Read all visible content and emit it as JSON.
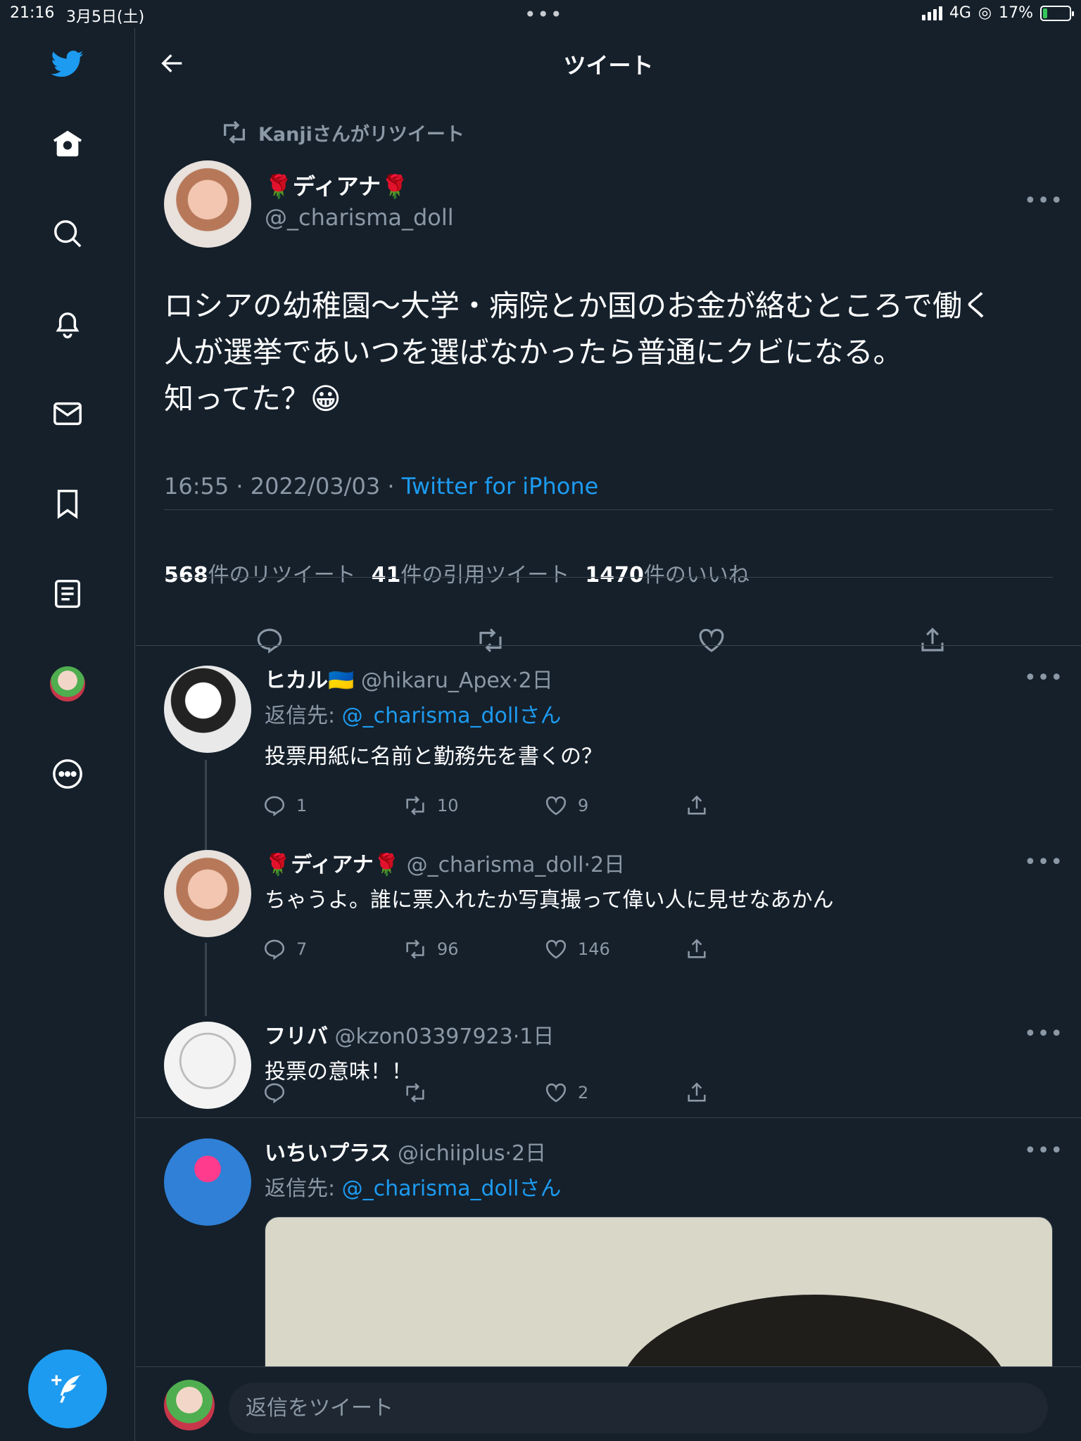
{
  "status_bar": {
    "time": "21:16",
    "date": "3月5日(土)",
    "network": "4G",
    "battery": "17%",
    "battery_level": 0.17
  },
  "header": {
    "title": "ツイート"
  },
  "retweet_indicator": "Kanjiさんがリツイート",
  "main_tweet": {
    "name": "🌹ディアナ🌹",
    "handle": "@_charisma_doll",
    "text": "ロシアの幼稚園〜大学・病院とか国のお金が絡むところで働く\n人が選挙であいつを選ばなかったら普通にクビになる。\n知ってた？😀",
    "timestamp": "16:55 · 2022/03/03 · ",
    "source": "Twitter for iPhone",
    "stats": {
      "retweets_count": "568",
      "retweets_label": "件のリツイート",
      "quotes_count": "41",
      "quotes_label": "件の引用ツイート",
      "likes_count": "1470",
      "likes_label": "件のいいね"
    }
  },
  "replies": [
    {
      "name": "ヒカル🇺🇦",
      "handle": "@hikaru_Apex",
      "time": "·2日",
      "reply_to_prefix": "返信先: ",
      "reply_to_handle": "@_charisma_dollさん",
      "text": "投票用紙に名前と勤務先を書くの？",
      "replies": "1",
      "retweets": "10",
      "likes": "9"
    },
    {
      "name": "🌹ディアナ🌹",
      "handle": "@_charisma_doll",
      "time": "·2日",
      "text": "ちゃうよ。誰に票入れたか写真撮って偉い人に見せなあかん",
      "replies": "7",
      "retweets": "96",
      "likes": "146"
    },
    {
      "name": "フリバ",
      "handle": "@kzon03397923",
      "time": "·1日",
      "text": "投票の意味！！",
      "replies": "",
      "retweets": "",
      "likes": "2"
    },
    {
      "name": "いちいプラス",
      "handle": "@ichiiplus",
      "time": "·2日",
      "reply_to_prefix": "返信先: ",
      "reply_to_handle": "@_charisma_dollさん"
    }
  ],
  "reply_bar": {
    "placeholder": "返信をツイート"
  },
  "icons": {
    "sidebar": [
      "twitter-logo-icon",
      "home-icon",
      "search-icon",
      "notifications-icon",
      "messages-icon",
      "bookmark-icon",
      "lists-icon",
      "profile-avatar",
      "more-icon"
    ],
    "actions": [
      "reply-icon",
      "retweet-icon",
      "like-icon",
      "share-icon"
    ]
  },
  "colors": {
    "background": "#15202b",
    "accent": "#1d9bf0",
    "muted": "#8b98a5",
    "divider": "#38444d"
  }
}
